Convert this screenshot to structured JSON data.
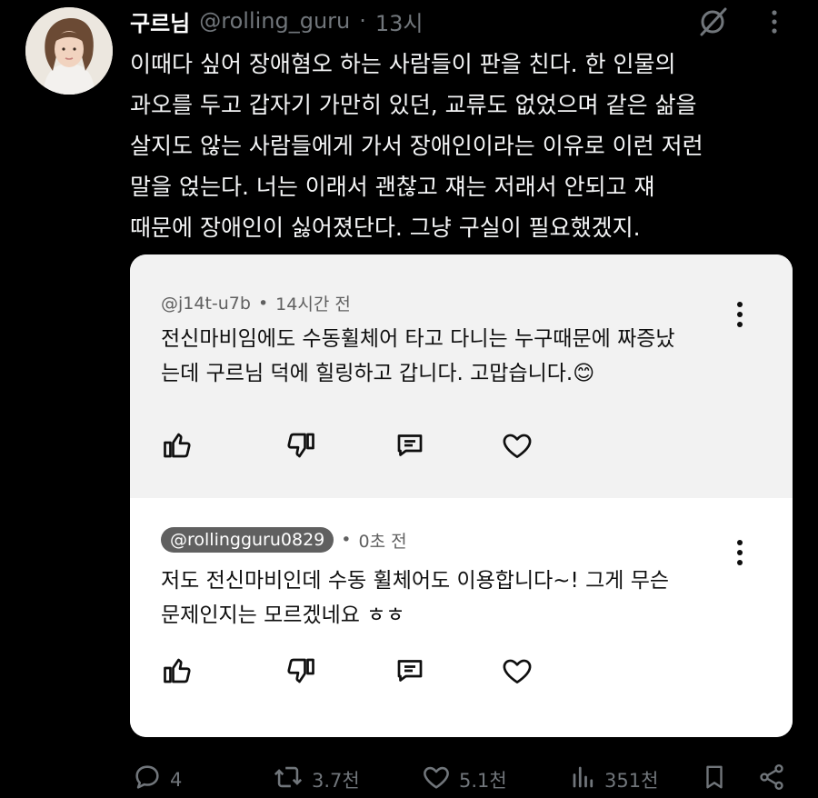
{
  "tweet": {
    "author_name": "구르님",
    "handle": "@rolling_guru",
    "separator": "·",
    "time": "13시",
    "text": "이때다 싶어 장애혐오 하는 사람들이 판을 친다. 한 인물의\n과오를 두고 갑자기 가만히 있던, 교류도 없었으며 같은 삶을\n살지도 않는 사람들에게 가서 장애인이라는 이유로 이런 저런\n말을 얹는다. 너는 이래서 괜찮고 쟤는 저래서 안되고 쟤\n때문에 장애인이 싫어졌단다. 그냥 구실이 필요했겠지."
  },
  "comments": [
    {
      "handle": "@j14t-u7b",
      "separator": "•",
      "time": "14시간 전",
      "text": "전신마비임에도 수동휠체어 타고 다니는 누구때문에 짜증났\n는데 구르님 덕에 힐링하고 갑니다. 고맙습니다.😊"
    },
    {
      "handle": "@rollingguru0829",
      "separator": "•",
      "time": "0초 전",
      "text": "저도 전신마비인데 수동 휠체어도 이용합니다~! 그게 무슨\n문제인지는 모르겠네요 ㅎㅎ"
    }
  ],
  "actions": {
    "replies": "4",
    "reposts": "3.7천",
    "likes": "5.1천",
    "views": "351천"
  },
  "icons": [
    "grok-icon",
    "more-icon",
    "thumbs-up-icon",
    "thumbs-down-icon",
    "reply-icon",
    "heart-icon",
    "comment-icon",
    "repost-icon",
    "like-icon",
    "views-icon",
    "bookmark-icon",
    "share-icon"
  ],
  "colors": {
    "background": "#000000",
    "muted": "#71767b",
    "card": "#f2f2f2",
    "pill": "#606060"
  }
}
